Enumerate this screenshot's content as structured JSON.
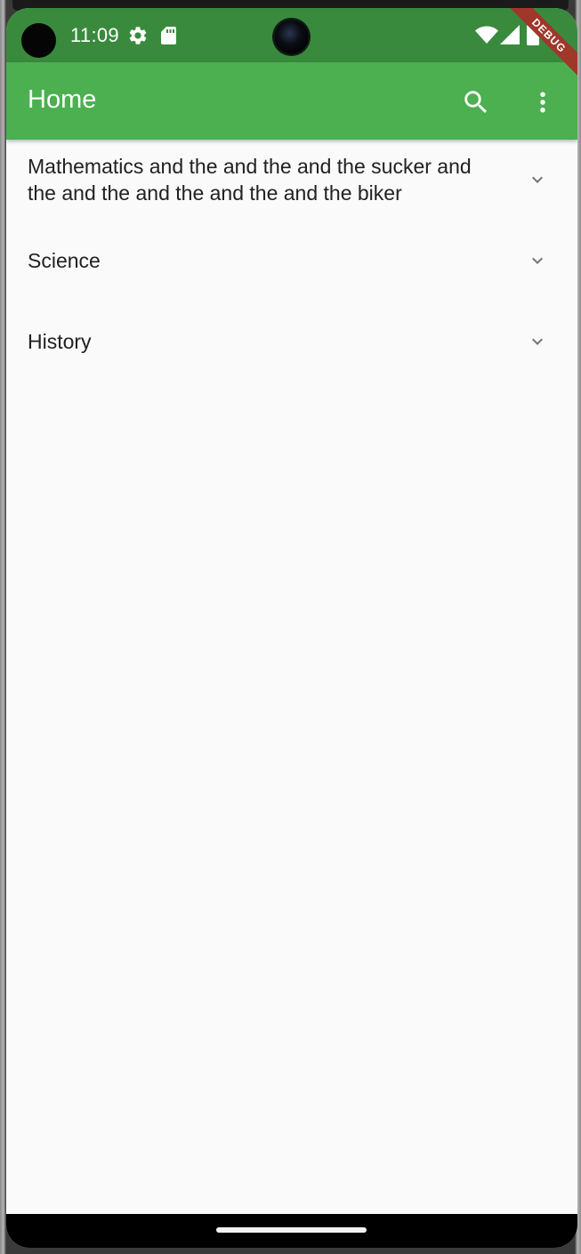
{
  "status_bar": {
    "time": "11:09",
    "icons": [
      "settings-gear-icon",
      "sd-card-icon",
      "wifi-icon",
      "cell-signal-icon",
      "battery-icon"
    ],
    "color": "#398a3d"
  },
  "debug_banner": {
    "label": "DEBUG",
    "color": "#a0372b"
  },
  "app_bar": {
    "title": "Home",
    "actions": [
      "search-icon",
      "more-vert-icon"
    ],
    "color": "#4caf50"
  },
  "tiles": [
    {
      "title": "Mathematics and the and the and the sucker and the and the and the and the and the biker",
      "icon": "chevron-down-icon",
      "expanded": false
    },
    {
      "title": "Science",
      "icon": "chevron-down-icon",
      "expanded": false
    },
    {
      "title": "History",
      "icon": "chevron-down-icon",
      "expanded": false
    }
  ],
  "colors": {
    "background": "#fafafa",
    "text": "#212121",
    "chevron": "#757575",
    "nav_bar": "#000000"
  }
}
